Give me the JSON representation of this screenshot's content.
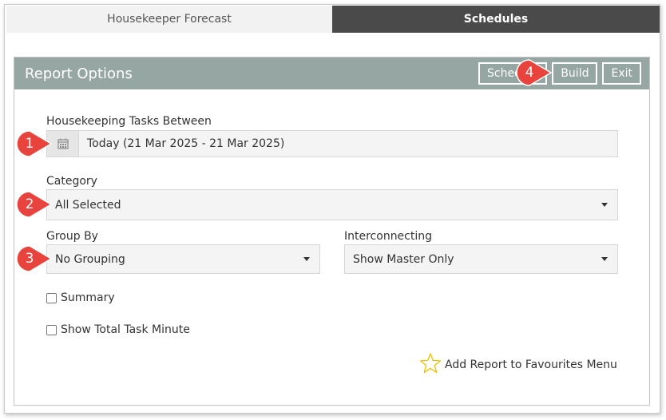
{
  "tabs": [
    {
      "label": "Housekeeper Forecast",
      "active": false
    },
    {
      "label": "Schedules",
      "active": true
    }
  ],
  "panel": {
    "title": "Report Options",
    "buttons": {
      "schedule": "Schedule",
      "build": "Build",
      "exit": "Exit"
    }
  },
  "form": {
    "tasks_between_label": "Housekeeping Tasks Between",
    "tasks_between_value": "Today (21 Mar 2025 - 21 Mar 2025)",
    "category_label": "Category",
    "category_value": "All Selected",
    "group_by_label": "Group By",
    "group_by_value": "No Grouping",
    "interconnecting_label": "Interconnecting",
    "interconnecting_value": "Show Master Only",
    "summary_label": "Summary",
    "show_total_label": "Show Total Task Minute",
    "favourites_label": "Add Report to Favourites Menu"
  },
  "markers": [
    "1",
    "2",
    "3",
    "4"
  ],
  "colors": {
    "header": "#96a6a3",
    "active_tab": "#4a4a4a",
    "marker": "#e8433c",
    "star": "#e8c200"
  },
  "icons": {
    "calendar": "calendar-icon",
    "dropdown": "caret-down-icon",
    "favourite": "star-outline-icon"
  }
}
